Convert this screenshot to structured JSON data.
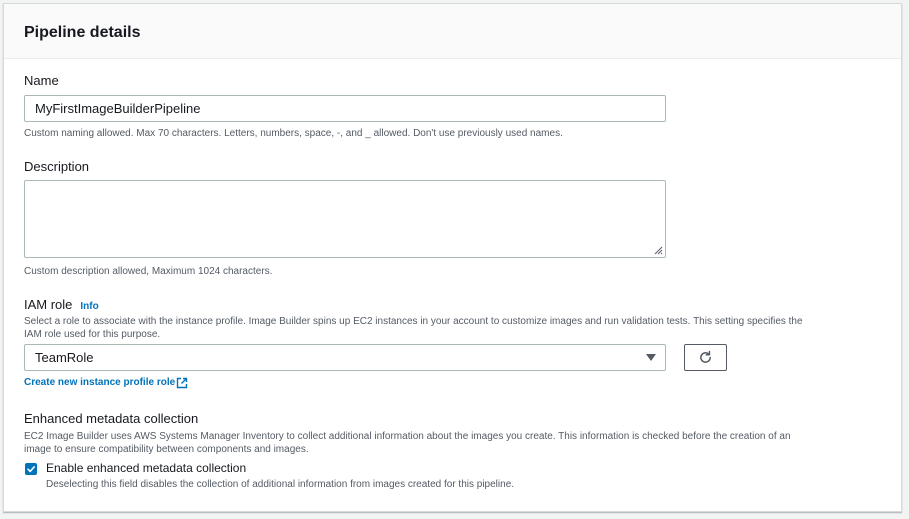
{
  "panel": {
    "title": "Pipeline details"
  },
  "name_field": {
    "label": "Name",
    "value": "MyFirstImageBuilderPipeline",
    "hint": "Custom naming allowed. Max 70 characters. Letters, numbers, space, -, and _ allowed. Don't use previously used names."
  },
  "description_field": {
    "label": "Description",
    "value": "",
    "hint": "Custom description allowed, Maximum 1024 characters."
  },
  "iam_role": {
    "label": "IAM role",
    "info_label": "Info",
    "hint_line1": "Select a role to associate with the instance profile. Image Builder spins up EC2 instances in your account to customize images and run validation tests. This setting specifies the",
    "hint_line2": "IAM role used for this purpose.",
    "selected": "TeamRole",
    "refresh_icon": "refresh-icon",
    "create_link": "Create new instance profile role"
  },
  "metadata": {
    "heading": "Enhanced metadata collection",
    "hint_line1": "EC2 Image Builder uses AWS Systems Manager Inventory to collect additional information about the images you create. This information is checked before the creation of an",
    "hint_line2": "image to ensure compatibility between components and images.",
    "checkbox_label": "Enable enhanced metadata collection",
    "checkbox_checked": true,
    "checkbox_hint": "Deselecting this field disables the collection of additional information from images created for this pipeline."
  },
  "colors": {
    "link": "#0073bb",
    "checkbox": "#0073bb",
    "hint_text": "#545b64",
    "border": "#aab7b8"
  }
}
